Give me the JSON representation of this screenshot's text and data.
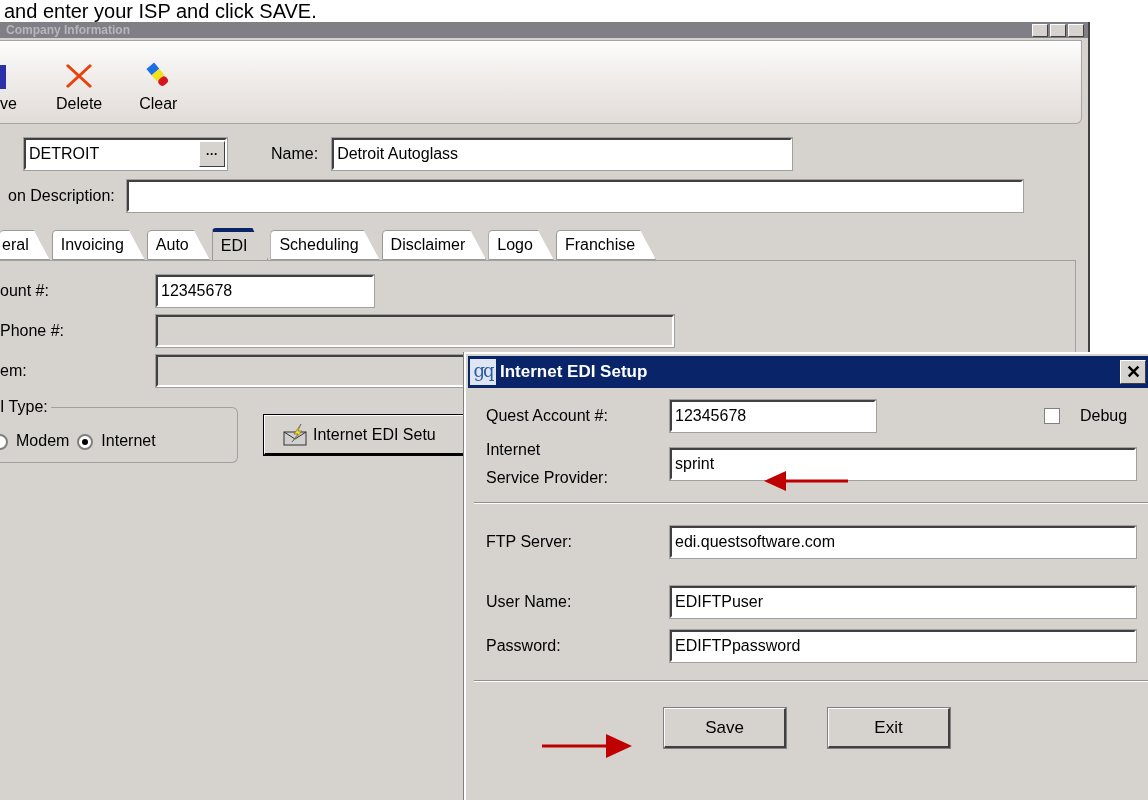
{
  "caption": "and enter your ISP and click SAVE.",
  "window": {
    "title": "Company Information",
    "toolbar": [
      {
        "kind": "save",
        "label": "ve"
      },
      {
        "kind": "delete",
        "label": "Delete"
      },
      {
        "kind": "clear",
        "label": "Clear"
      }
    ],
    "code": {
      "value": "DETROIT",
      "button_label": "···"
    },
    "name": {
      "label": "Name:",
      "value": "Detroit Autoglass"
    },
    "description": {
      "label": "on Description:"
    },
    "tabs": [
      {
        "label": "eral",
        "selected": false
      },
      {
        "label": "Invoicing",
        "selected": false
      },
      {
        "label": "Auto",
        "selected": false
      },
      {
        "label": "EDI",
        "selected": true
      },
      {
        "label": "Scheduling",
        "selected": false
      },
      {
        "label": "Disclaimer",
        "selected": false
      },
      {
        "label": "Logo",
        "selected": false
      },
      {
        "label": "Franchise",
        "selected": false
      }
    ],
    "edi": {
      "fields": [
        {
          "label": "ount #:",
          "value": "12345678",
          "disabled": false
        },
        {
          "label": " Phone #:",
          "disabled": true
        },
        {
          "label": "em:",
          "disabled": true
        }
      ],
      "type_group": {
        "label": "I Type:",
        "options": [
          {
            "label": "Modem",
            "selected": false
          },
          {
            "label": "Internet",
            "selected": true
          }
        ]
      },
      "setup_button": "Internet EDI Setu"
    }
  },
  "dialog": {
    "logo": "gq",
    "title": "Internet EDI Setup",
    "close_label": "✕",
    "account": {
      "label": "Quest Account #:",
      "value": "12345678"
    },
    "debug": {
      "label": "Debug",
      "checked": false
    },
    "isp": {
      "label_lines": [
        "Internet",
        "Service Provider:"
      ],
      "value": "sprint"
    },
    "server_fields": [
      {
        "label": "FTP Server:",
        "value": "edi.questsoftware.com"
      },
      {
        "label": "User Name:",
        "value": "EDIFTPuser"
      },
      {
        "label": "Password:",
        "value": "EDIFTPpassword"
      }
    ],
    "buttons": [
      "Save",
      "Exit"
    ]
  }
}
